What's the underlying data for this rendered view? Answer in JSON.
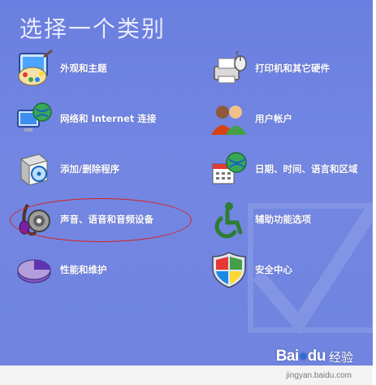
{
  "title": "选择一个类别",
  "categories": [
    {
      "label": "外观和主题",
      "icon": "appearance-icon"
    },
    {
      "label": "打印机和其它硬件",
      "icon": "printer-icon"
    },
    {
      "label": "网络和 Internet 连接",
      "icon": "network-icon"
    },
    {
      "label": "用户帐户",
      "icon": "users-icon"
    },
    {
      "label": "添加/删除程序",
      "icon": "programs-icon"
    },
    {
      "label": "日期、时间、语言和区域",
      "icon": "date-time-icon"
    },
    {
      "label": "声音、语音和音频设备",
      "icon": "sound-icon"
    },
    {
      "label": "辅助功能选项",
      "icon": "accessibility-icon"
    },
    {
      "label": "性能和维护",
      "icon": "performance-icon"
    },
    {
      "label": "安全中心",
      "icon": "security-icon"
    }
  ],
  "highlight_color": "#d8201f",
  "watermark": {
    "logo": "Bai🐾百度",
    "logo_text": "Bai",
    "logo_text2": "du",
    "brand": "经验",
    "url": "jingyan.baidu.com"
  }
}
